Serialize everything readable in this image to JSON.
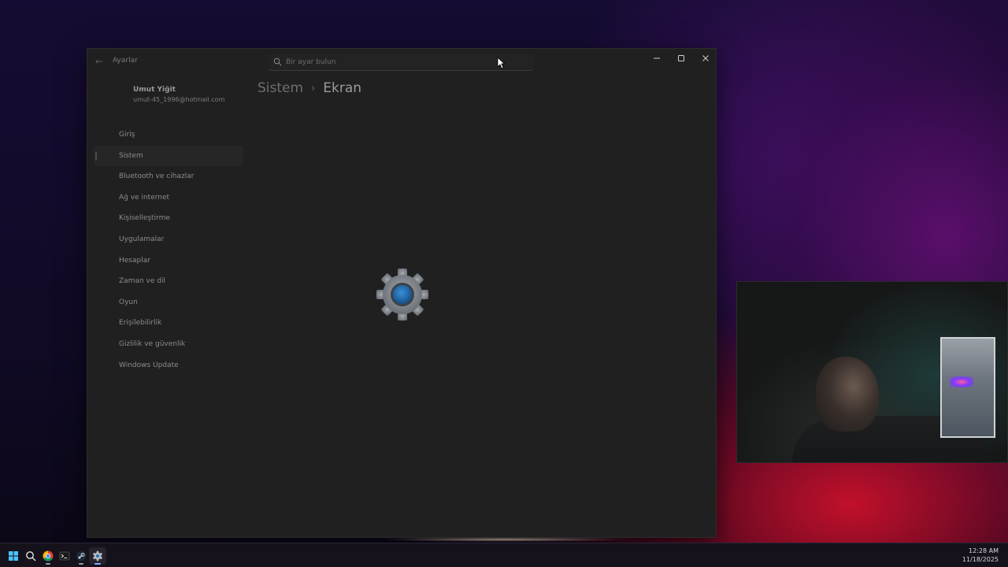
{
  "window": {
    "title": "Ayarlar",
    "search_placeholder": "Bir ayar bulun"
  },
  "profile": {
    "name": "Umut Yiğit",
    "email": "umut-45_1996@hotmail.com"
  },
  "nav": {
    "items": [
      {
        "label": "Giriş"
      },
      {
        "label": "Sistem"
      },
      {
        "label": "Bluetooth ve cihazlar"
      },
      {
        "label": "Ağ ve internet"
      },
      {
        "label": "Kişiselleştirme"
      },
      {
        "label": "Uygulamalar"
      },
      {
        "label": "Hesaplar"
      },
      {
        "label": "Zaman ve dil"
      },
      {
        "label": "Oyun"
      },
      {
        "label": "Erişilebilirlik"
      },
      {
        "label": "Gizlilik ve güvenlik"
      },
      {
        "label": "Windows Update"
      }
    ],
    "selected": "Sistem"
  },
  "breadcrumb": {
    "parent": "Sistem",
    "separator": "›",
    "current": "Ekran"
  },
  "taskbar": {
    "icons": [
      "windows-start-icon",
      "search-icon",
      "chrome-icon",
      "terminal-icon",
      "steam-icon",
      "settings-icon"
    ],
    "time": "12:28 AM",
    "date": "11/18/2025"
  },
  "colors": {
    "accent": "#1f6fb0",
    "window_bg": "#202020"
  }
}
